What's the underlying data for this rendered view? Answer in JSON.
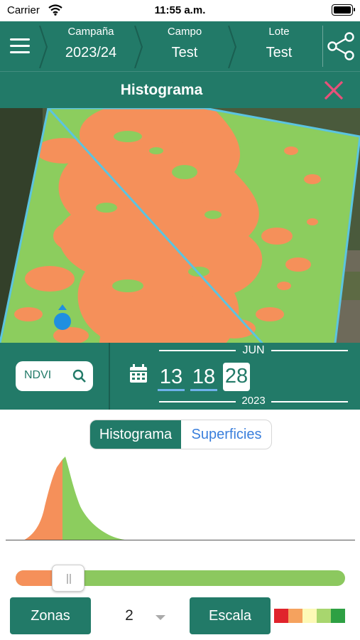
{
  "status_bar": {
    "carrier": "Carrier",
    "time": "11:55 a.m."
  },
  "nav": {
    "breadcrumbs": [
      {
        "label": "Campaña",
        "value": "2023/24"
      },
      {
        "label": "Campo",
        "value": "Test"
      },
      {
        "label": "Lote",
        "value": "Test"
      }
    ]
  },
  "header": {
    "title": "Histograma"
  },
  "controls": {
    "index_selector": "NDVI",
    "month": "JUN",
    "year": "2023",
    "days": [
      {
        "label": "13",
        "selected": false
      },
      {
        "label": "18",
        "selected": false
      },
      {
        "label": "28",
        "selected": true
      }
    ]
  },
  "panel": {
    "tabs": [
      {
        "label": "Histograma",
        "active": true
      },
      {
        "label": "Superficies",
        "active": false
      }
    ],
    "slider_fraction": 0.16,
    "zonas_label": "Zonas",
    "zonas_value": "2",
    "escala_label": "Escala",
    "scale_colors": [
      "#e0242c",
      "#f5a25e",
      "#fdf9b6",
      "#a8d66e",
      "#2ea043"
    ]
  },
  "colors": {
    "primary": "#227a68",
    "low_zone": "#f5905a",
    "high_zone": "#8cc85f",
    "close": "#e8507a",
    "link": "#3a7fdc"
  }
}
